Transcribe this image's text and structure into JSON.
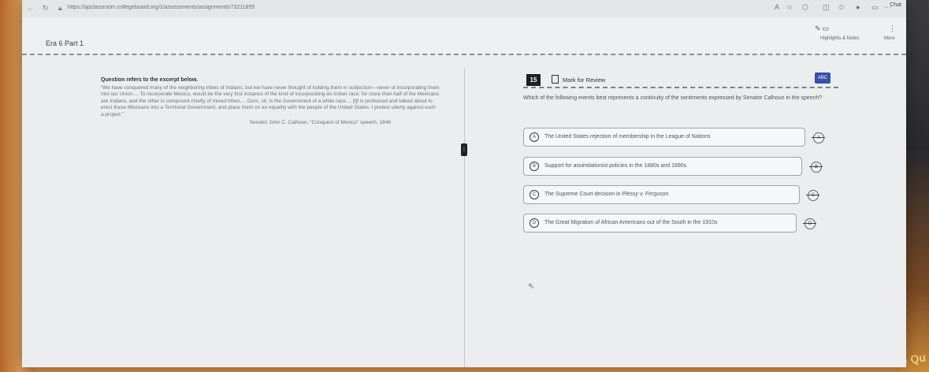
{
  "browser": {
    "url": "https://apclassroom.collegeboard.org/1/assessments/assignments/73211855",
    "chat_label": "Chat"
  },
  "header": {
    "section_title": "Era 6 Part 1",
    "highlights_label": "Highlights & Notes",
    "more_label": "More"
  },
  "passage": {
    "intro": "Question refers to the excerpt below.",
    "text": "“We have conquered many of the neighboring tribes of Indians, but we have never thought of holding them in subjection—never of incorporating them into our Union.... To incorporate Mexico, would be the very first instance of the kind of incorporating an Indian race; for more than half of the Mexicans are Indians, and the other is composed chiefly of mixed tribes.... Ours, sir, is the Government of a white race.... [I]t is professed and talked about to erect these Mexicans into a Territorial Government, and place them on an equality with the people of the United States. I protest utterly against such a project.”",
    "citation": "Senator John C. Calhoun, “Conquest of Mexico” speech, 1848"
  },
  "question": {
    "number": "15",
    "mark_label": "Mark for Review",
    "abc_label": "ABC",
    "prompt": "Which of the following events best represents a continuity of the sentiments expressed by Senator Calhoun in the speech?",
    "choices": [
      {
        "letter": "A",
        "text": "The United States rejection of membership in the League of Nations"
      },
      {
        "letter": "B",
        "text": "Support for assimilationist policies in the 1880s and 1890s"
      },
      {
        "letter": "C",
        "text": "The Supreme Court decision in Plessy v. Ferguson"
      },
      {
        "letter": "D",
        "text": "The Great Migration of African Americans out of the South in the 1910s"
      }
    ]
  },
  "overlay": {
    "snippet": "ce Qu"
  }
}
